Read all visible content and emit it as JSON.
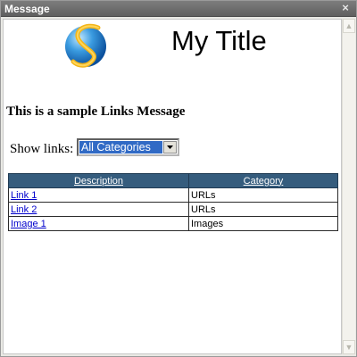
{
  "window": {
    "title": "Message",
    "close_icon": "close-icon"
  },
  "header": {
    "logo_icon": "globe-s-logo",
    "title": "My Title"
  },
  "message": {
    "title": "This is a sample Links Message"
  },
  "filter": {
    "label": "Show links:",
    "selected": "All Categories"
  },
  "table": {
    "headers": {
      "description": "Description",
      "category": "Category"
    },
    "rows": [
      {
        "description": "Link 1",
        "category": "URLs"
      },
      {
        "description": "Link 2",
        "category": "URLs"
      },
      {
        "description": "Image 1",
        "category": "Images"
      }
    ]
  },
  "colors": {
    "header_bg": "#355c7d",
    "titlebar": "#6e6e6e",
    "selection": "#316ac5",
    "link": "#0000cc"
  }
}
